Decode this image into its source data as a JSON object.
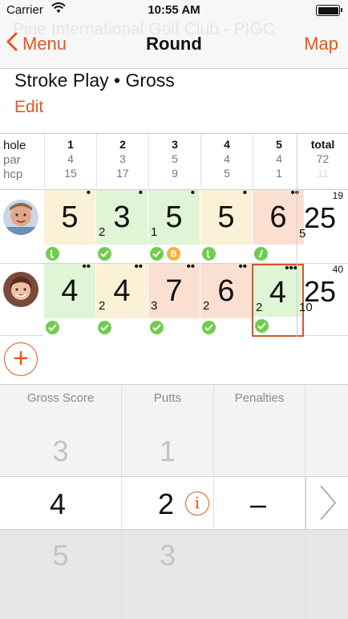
{
  "status_bar": {
    "carrier": "Carrier",
    "time": "10:55 AM"
  },
  "nav": {
    "back_label": "Menu",
    "title": "Round",
    "right_label": "Map",
    "background_text": "Pine International Golf Club - PIGC"
  },
  "round_type": "Stroke Play • Gross",
  "edit_label": "Edit",
  "scorecard": {
    "labels": {
      "hole": "hole",
      "par": "par",
      "hcp": "hcp"
    },
    "holes": [
      {
        "num": "1",
        "par": "4",
        "hcp": "15"
      },
      {
        "num": "2",
        "par": "3",
        "hcp": "17"
      },
      {
        "num": "3",
        "par": "5",
        "hcp": "9"
      },
      {
        "num": "4",
        "par": "4",
        "hcp": "5"
      },
      {
        "num": "5",
        "par": "4",
        "hcp": "1"
      }
    ],
    "total": {
      "label": "total",
      "par": "72",
      "hcp": "11"
    },
    "players": [
      {
        "total": {
          "score": "25",
          "putts": "5",
          "points": "19"
        },
        "cells": [
          {
            "score": "5",
            "putts": "",
            "dots": "•",
            "color": "#fbf1d6",
            "stats": [
              "driver"
            ]
          },
          {
            "score": "3",
            "putts": "2",
            "dots": "•",
            "color": "#dff5d6",
            "stats": [
              "check"
            ]
          },
          {
            "score": "5",
            "putts": "1",
            "dots": "•",
            "color": "#dff5d6",
            "stats": [
              "check",
              "bunker"
            ]
          },
          {
            "score": "5",
            "putts": "",
            "dots": "•",
            "color": "#fbf1d6",
            "stats": [
              "driver"
            ]
          },
          {
            "score": "6",
            "putts": "",
            "dots": "••",
            "color": "#fbe0d2",
            "stats": [
              "fairway-left"
            ]
          }
        ]
      },
      {
        "total": {
          "score": "25",
          "putts": "10",
          "points": "40"
        },
        "cells": [
          {
            "score": "4",
            "putts": "",
            "dots": "••",
            "color": "#dff5d6",
            "stats": [
              "check"
            ]
          },
          {
            "score": "4",
            "putts": "2",
            "dots": "••",
            "color": "#fbf1d6",
            "stats": [
              "check"
            ]
          },
          {
            "score": "7",
            "putts": "3",
            "dots": "••",
            "color": "#fbe0d2",
            "stats": [
              "check"
            ]
          },
          {
            "score": "6",
            "putts": "2",
            "dots": "••",
            "color": "#fbe0d2",
            "stats": [
              "check"
            ]
          },
          {
            "score": "4",
            "putts": "2",
            "dots": "•••",
            "color": "#dff5d6",
            "stats": [
              "check"
            ],
            "selected": true
          }
        ]
      }
    ]
  },
  "picker": {
    "columns": [
      {
        "header": "Gross Score",
        "above": "3",
        "selected": "4",
        "below": "5"
      },
      {
        "header": "Putts",
        "above": "1",
        "selected": "2",
        "below": "3"
      },
      {
        "header": "Penalties",
        "above": "",
        "selected": "–",
        "below": ""
      }
    ],
    "info_glyph": "i",
    "bunker_glyph": "B"
  },
  "colors": {
    "accent": "#e8541e",
    "green": "#6fcd4d",
    "orange": "#f4b33a"
  }
}
